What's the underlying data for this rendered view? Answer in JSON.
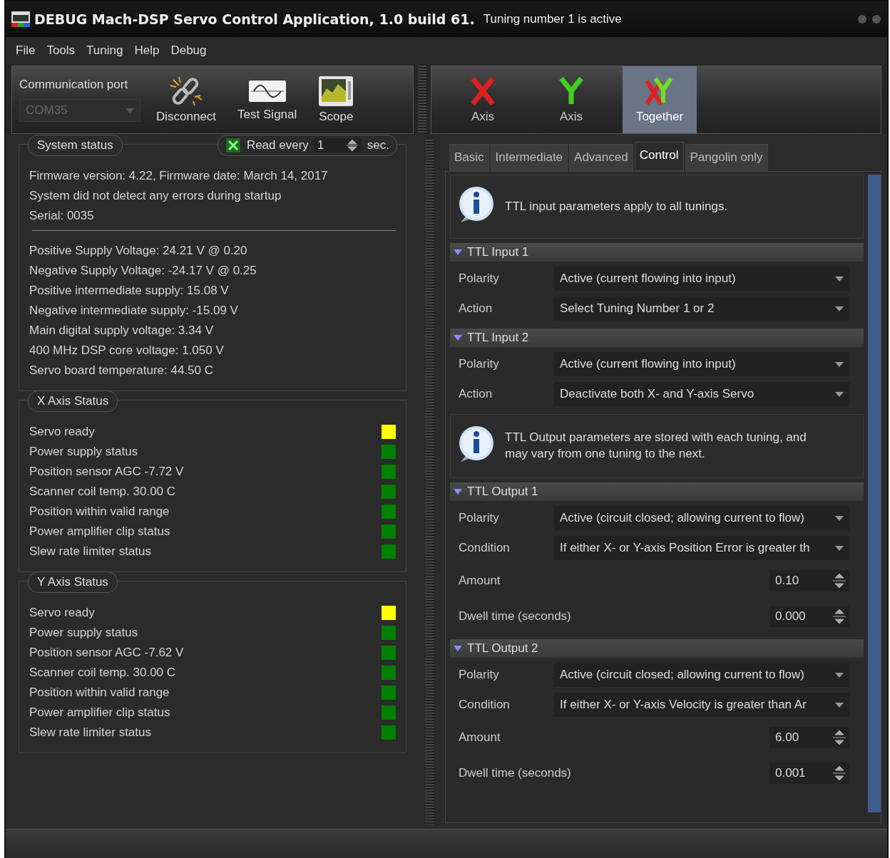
{
  "window": {
    "title": "DEBUG Mach-DSP Servo Control Application, 1.0 build 61.",
    "subtitle": "Tuning number 1 is active"
  },
  "menu": [
    "File",
    "Tools",
    "Tuning",
    "Help",
    "Debug"
  ],
  "toolbar": {
    "port_label": "Communication port",
    "port_value": "COM35",
    "port_disabled": true,
    "buttons": [
      {
        "label": "Disconnect",
        "kind": "disconnect"
      },
      {
        "label": "Test Signal",
        "kind": "signal"
      },
      {
        "label": "Scope",
        "kind": "scope"
      }
    ],
    "axes": [
      {
        "label": "Axis",
        "kind": "x",
        "selected": false
      },
      {
        "label": "Axis",
        "kind": "y",
        "selected": false
      },
      {
        "label": "Together",
        "kind": "xy",
        "selected": true
      }
    ]
  },
  "system_status": {
    "title": "System status",
    "read_checked": true,
    "read_label": "Read every",
    "read_value": "1",
    "read_unit": "sec.",
    "info": [
      "Firmware version: 4.22, Firmware date: March 14, 2017",
      "System did not detect any errors during startup",
      "Serial: 0035"
    ],
    "readings": [
      "Positive Supply Voltage: 24.21 V @ 0.20",
      "Negative Supply Voltage: -24.17 V @ 0.25",
      "Positive intermediate supply: 15.08 V",
      "Negative intermediate supply: -15.09 V",
      "Main digital supply voltage: 3.34 V",
      "400 MHz DSP core voltage: 1.050 V",
      "Servo board temperature: 44.50 C"
    ]
  },
  "axis_status": [
    {
      "title": "X Axis Status",
      "items": [
        {
          "label": "Servo ready",
          "color": "#ffff00"
        },
        {
          "label": "Power supply status",
          "color": "#008000"
        },
        {
          "label": "Position sensor AGC -7.72 V",
          "color": "#008000"
        },
        {
          "label": "Scanner coil temp. 30.00 C",
          "color": "#008000"
        },
        {
          "label": "Position within valid range",
          "color": "#008000"
        },
        {
          "label": "Power amplifier clip status",
          "color": "#008000"
        },
        {
          "label": "Slew rate limiter status",
          "color": "#008000"
        }
      ]
    },
    {
      "title": "Y Axis Status",
      "items": [
        {
          "label": "Servo ready",
          "color": "#ffff00"
        },
        {
          "label": "Power supply status",
          "color": "#008000"
        },
        {
          "label": "Position sensor AGC -7.62 V",
          "color": "#008000"
        },
        {
          "label": "Scanner coil temp. 30.00 C",
          "color": "#008000"
        },
        {
          "label": "Position within valid range",
          "color": "#008000"
        },
        {
          "label": "Power amplifier clip status",
          "color": "#008000"
        },
        {
          "label": "Slew rate limiter status",
          "color": "#008000"
        }
      ]
    }
  ],
  "tabs": [
    {
      "label": "Basic",
      "selected": false
    },
    {
      "label": "Intermediate",
      "selected": false
    },
    {
      "label": "Advanced",
      "selected": false
    },
    {
      "label": "Control",
      "selected": true
    },
    {
      "label": "Pangolin only",
      "selected": false
    }
  ],
  "blocks": [
    {
      "kind": "info",
      "text": "TTL input parameters apply to all tunings."
    },
    {
      "kind": "section",
      "title": "TTL Input 1",
      "expanded": true,
      "rows": [
        {
          "kind": "dropdown",
          "label": "Polarity",
          "value": "Active (current flowing into input)"
        },
        {
          "kind": "dropdown",
          "label": "Action",
          "value": "Select Tuning Number 1 or 2"
        }
      ]
    },
    {
      "kind": "section",
      "title": "TTL Input 2",
      "expanded": true,
      "rows": [
        {
          "kind": "dropdown",
          "label": "Polarity",
          "value": "Active (current flowing into input)"
        },
        {
          "kind": "dropdown",
          "label": "Action",
          "value": "Deactivate both X- and Y-axis Servo"
        }
      ]
    },
    {
      "kind": "info",
      "text": "TTL Output parameters are stored with each tuning, and may vary from one tuning to the next."
    },
    {
      "kind": "section",
      "title": "TTL Output 1",
      "expanded": true,
      "rows": [
        {
          "kind": "dropdown",
          "label": "Polarity",
          "value": "Active (circuit closed; allowing current to flow)"
        },
        {
          "kind": "dropdown",
          "label": "Condition",
          "value": "If either X- or Y-axis Position Error is greater th"
        },
        {
          "kind": "spinner",
          "label": "Amount",
          "value": "0.10"
        },
        {
          "kind": "spinner",
          "label": "Dwell time (seconds)",
          "value": "0.000"
        }
      ]
    },
    {
      "kind": "section",
      "title": "TTL Output 2",
      "expanded": true,
      "rows": [
        {
          "kind": "dropdown",
          "label": "Polarity",
          "value": "Active (circuit closed; allowing current to flow)"
        },
        {
          "kind": "dropdown",
          "label": "Condition",
          "value": "If either X- or Y-axis Velocity is greater than Ar"
        },
        {
          "kind": "spinner",
          "label": "Amount",
          "value": "6.00"
        },
        {
          "kind": "spinner",
          "label": "Dwell time (seconds)",
          "value": "0.001"
        }
      ]
    }
  ]
}
